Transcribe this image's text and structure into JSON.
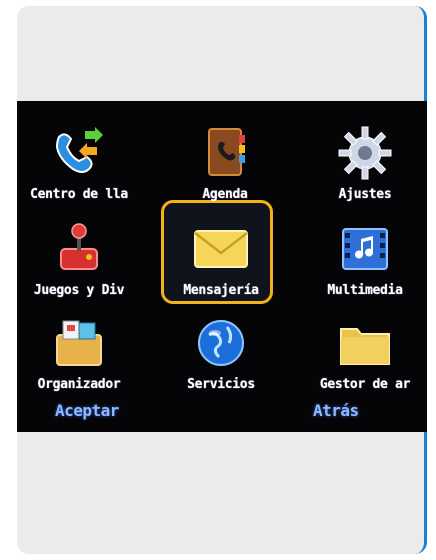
{
  "menu": {
    "items": [
      {
        "label": "Centro de lla",
        "icon": "phone-calls-icon"
      },
      {
        "label": "Agenda",
        "icon": "address-book-icon"
      },
      {
        "label": "Ajustes",
        "icon": "settings-gear-icon"
      },
      {
        "label": "Juegos y Div",
        "icon": "joystick-icon"
      },
      {
        "label": "Mensajería",
        "icon": "envelope-icon",
        "selected": true
      },
      {
        "label": "Multimedia",
        "icon": "film-music-icon"
      },
      {
        "label": "Organizador",
        "icon": "organizer-calendar-icon"
      },
      {
        "label": "Servicios",
        "icon": "globe-icon"
      },
      {
        "label": "Gestor de ar",
        "icon": "folder-icon"
      }
    ],
    "selection_color": "#f3b317"
  },
  "softkeys": {
    "left": "Aceptar",
    "right": "Atrás"
  }
}
